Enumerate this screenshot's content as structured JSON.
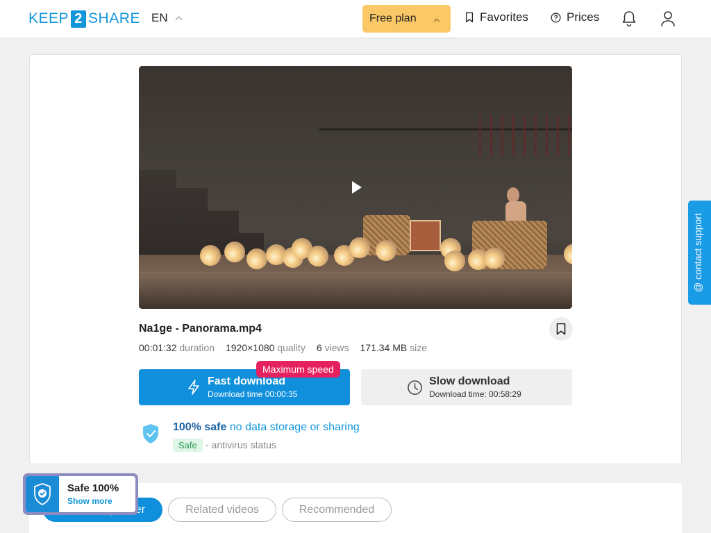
{
  "header": {
    "logo_left": "KEEP",
    "logo_mid": "2",
    "logo_right": "SHARE",
    "language": "EN",
    "plan_label": "Free plan",
    "favorites_label": "Favorites",
    "prices_label": "Prices"
  },
  "file": {
    "name": "Na1ge - Panorama.mp4",
    "duration_value": "00:01:32",
    "duration_label": "duration",
    "quality_value": "1920×1080",
    "quality_label": "quality",
    "views_value": "6",
    "views_label": "views",
    "size_value": "171.34 MB",
    "size_label": "size"
  },
  "download": {
    "fast_title": "Fast download",
    "fast_sub": "Download time 00:00:35",
    "max_speed_badge": "Maximum speed",
    "slow_title": "Slow download",
    "slow_sub": "Download time: 00:58:29"
  },
  "safety": {
    "headline_bold": "100% safe",
    "headline_rest": "no data storage or sharing",
    "badge": "Safe",
    "status": "- antivirus status"
  },
  "tabs": [
    "From this partner",
    "Related videos",
    "Recommended"
  ],
  "safe_widget": {
    "title": "Safe 100%",
    "more": "Show more"
  },
  "support_label": "contact support",
  "colors": {
    "accent": "#0f8fdc",
    "plan": "#fbc867",
    "max_speed": "#e6215f"
  }
}
